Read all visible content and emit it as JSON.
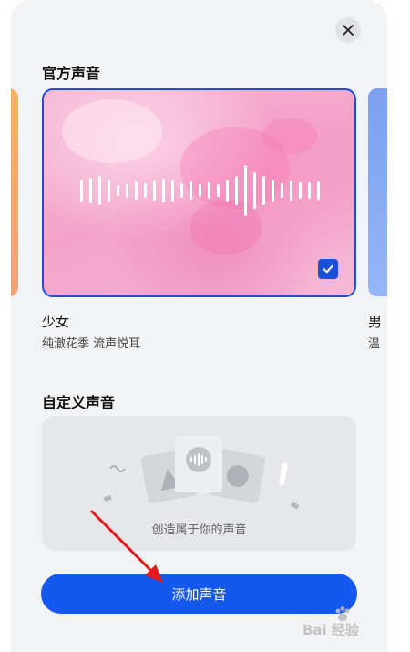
{
  "header": {
    "close_icon": "close-icon"
  },
  "official": {
    "title": "官方声音",
    "selected_voice": {
      "name": "少女",
      "description": "纯澈花季 流声悦耳",
      "selected": true
    },
    "next_voice": {
      "name_partial": "男",
      "description_partial": "温"
    }
  },
  "custom": {
    "title": "自定义声音",
    "hint": "创造属于你的声音"
  },
  "actions": {
    "add_label": "添加声音"
  },
  "watermark": {
    "text": "Bai 经验"
  },
  "colors": {
    "accent": "#1558f0",
    "selected_border": "#1c4fd8",
    "sheet_bg": "#f2f3f5"
  }
}
